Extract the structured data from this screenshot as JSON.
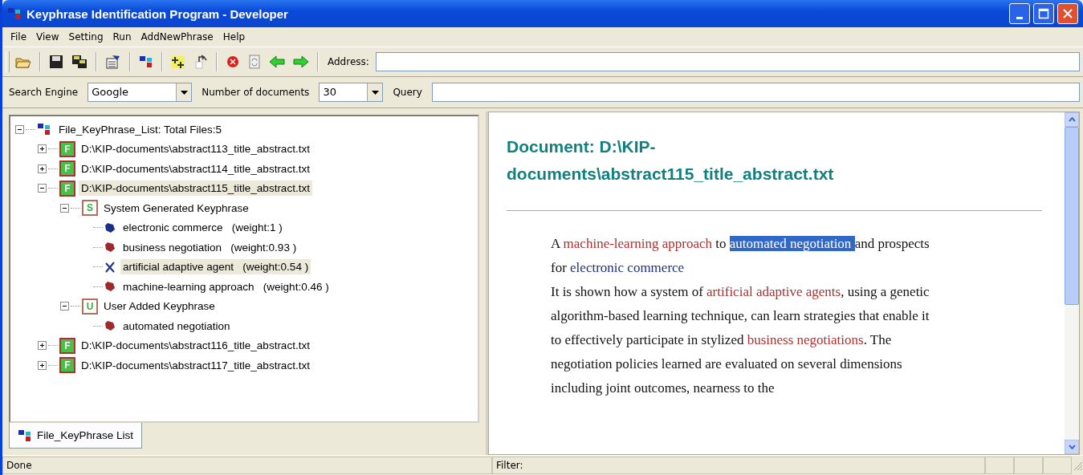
{
  "window": {
    "title": "Keyphrase Identification Program - Developer"
  },
  "menu": [
    "File",
    "View",
    "Setting",
    "Run",
    "AddNewPhrase",
    "Help"
  ],
  "address": {
    "label": "Address:"
  },
  "search": {
    "engine_label": "Search Engine",
    "engine": "Google",
    "count_label": "Number of documents",
    "count": "30",
    "query_label": "Query"
  },
  "tree": {
    "kind": "root",
    "label": "File_KeyPhrase_List: Total Files:5",
    "expanded": true,
    "selected": false,
    "children": [
      {
        "kind": "file",
        "badge": "F",
        "label": "D:\\KIP-documents\\abstract113_title_abstract.txt",
        "expanded": false,
        "selected": false
      },
      {
        "kind": "file",
        "badge": "F",
        "label": "D:\\KIP-documents\\abstract114_title_abstract.txt",
        "expanded": false,
        "selected": false
      },
      {
        "kind": "file",
        "badge": "F",
        "label": "D:\\KIP-documents\\abstract115_title_abstract.txt",
        "expanded": true,
        "selected": true,
        "children": [
          {
            "kind": "group",
            "badge": "S",
            "label": "System Generated Keyphrase",
            "expanded": true,
            "selected": false,
            "children": [
              {
                "kind": "phrase",
                "color": "#1c2e8c",
                "label": "electronic commerce",
                "weight": "(weight:1 )",
                "selected": false
              },
              {
                "kind": "phrase",
                "color": "#9c2a2a",
                "label": "business negotiation",
                "weight": "(weight:0.93 )",
                "selected": false
              },
              {
                "kind": "marked",
                "color": "#1c2e8c",
                "label": "artificial adaptive agent",
                "weight": "(weight:0.54 )",
                "selected": true
              },
              {
                "kind": "phrase",
                "color": "#9c2a2a",
                "label": "machine-learning approach",
                "weight": "(weight:0.46 )",
                "selected": false
              }
            ]
          },
          {
            "kind": "group",
            "badge": "U",
            "label": "User Added Keyphrase",
            "expanded": true,
            "selected": false,
            "children": [
              {
                "kind": "phrase",
                "color": "#9c2a2a",
                "label": "automated negotiation",
                "selected": false
              }
            ]
          }
        ]
      },
      {
        "kind": "file",
        "badge": "F",
        "label": "D:\\KIP-documents\\abstract116_title_abstract.txt",
        "expanded": false,
        "selected": false
      },
      {
        "kind": "file",
        "badge": "F",
        "label": "D:\\KIP-documents\\abstract117_title_abstract.txt",
        "expanded": false,
        "selected": false
      }
    ]
  },
  "tab": {
    "label": "File_KeyPhrase List"
  },
  "document": {
    "title": "Document: D:\\KIP-documents\\abstract115_title_abstract.txt",
    "paragraphs": [
      [
        {
          "kind": "text",
          "text": "A "
        },
        {
          "kind": "phrase",
          "color": "#a83232",
          "text": "machine-learning approach"
        },
        {
          "kind": "text",
          "text": " to "
        },
        {
          "kind": "selected",
          "text": "automated negotiation "
        },
        {
          "kind": "text",
          "text": "and prospects for "
        },
        {
          "kind": "phrase",
          "color": "#22307a",
          "text": "electronic commerce"
        }
      ],
      [
        {
          "kind": "text",
          "text": "It is shown how a system of "
        },
        {
          "kind": "phrase",
          "color": "#a83232",
          "text": "artificial adaptive agents"
        },
        {
          "kind": "text",
          "text": ", using a genetic algorithm-based learning technique, can learn strategies that enable it to effectively participate in stylized "
        },
        {
          "kind": "phrase",
          "color": "#a83232",
          "text": "business negotiations"
        },
        {
          "kind": "text",
          "text": ". The negotiation policies learned are evaluated on several dimensions including joint outcomes, nearness to the"
        }
      ]
    ]
  },
  "status_bar": [
    "Done",
    "Filter:"
  ]
}
